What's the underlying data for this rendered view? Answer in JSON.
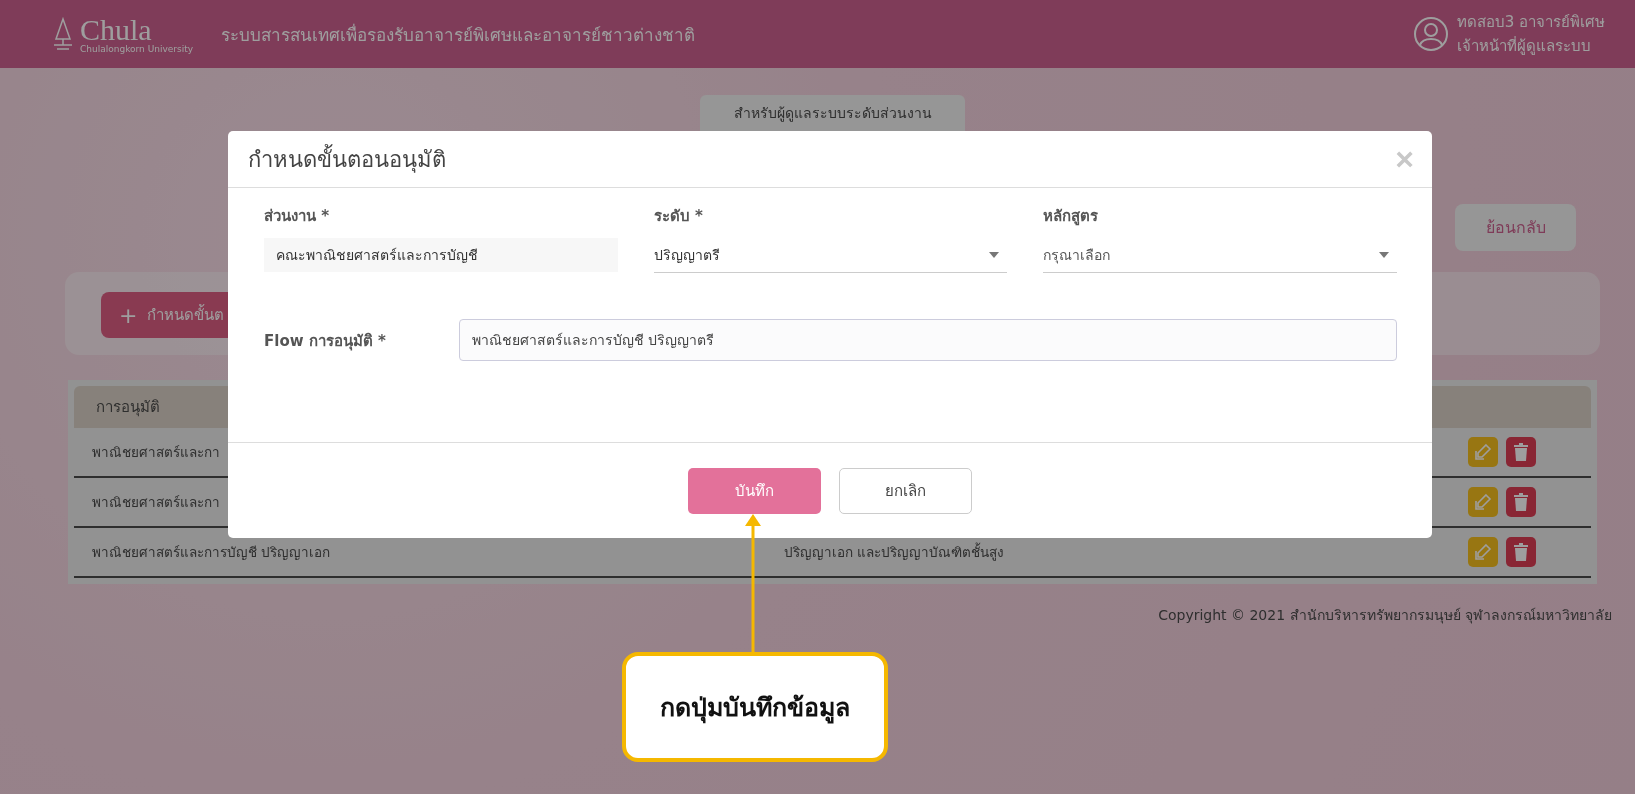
{
  "header": {
    "logo": {
      "name": "Chula",
      "subtitle": "Chulalongkorn University"
    },
    "system_title": "ระบบสารสนเทศเพื่อรองรับอาจารย์พิเศษและอาจารย์ชาวต่างชาติ",
    "user_name": "ทดสอบ3 อาจารย์พิเศษ",
    "user_role": "เจ้าหน้าที่ผู้ดูแลระบบ"
  },
  "tab": "สำหรับผู้ดูแลระบบระดับส่วนงาน",
  "back_button": "ย้อนกลับ",
  "add_button": {
    "icon": "+",
    "label": "กำหนดขั้นต"
  },
  "table": {
    "columns": [
      "การอนุมัติ"
    ],
    "rows": [
      {
        "cells": [
          "พาณิชยศาสตร์และกา"
        ]
      },
      {
        "cells": [
          "พาณิชยศาสตร์และกา"
        ]
      },
      {
        "cells": [
          "พาณิชยศาสตร์และการบัญชี ปริญญาเอก",
          "ปริญญาเอก และปริญญาบัณฑิตชั้นสูง"
        ]
      }
    ]
  },
  "copyright": "Copyright © 2021 สำนักบริหารทรัพยากรมนุษย์ จุฬาลงกรณ์มหาวิทยาลัย",
  "dialog": {
    "title": "กำหนดขั้นตอนอนุมัติ",
    "close": "×",
    "fields": [
      {
        "label": "ส่วนงาน *",
        "value": "คณะพาณิชยศาสตร์และการบัญชี",
        "kind": "readonly"
      },
      {
        "label": "ระดับ *",
        "value": "ปริญญาตรี",
        "kind": "select"
      },
      {
        "label": "หลักสูตร",
        "placeholder": "กรุณาเลือก",
        "kind": "select"
      }
    ],
    "flow": {
      "label": "Flow การอนุมัติ *",
      "value": "พาณิชยศาสตร์และการบัญชี ปริญญาตรี"
    },
    "buttons": [
      {
        "label": "บันทึก",
        "kind": "primary"
      },
      {
        "label": "ยกเลิก",
        "kind": "secondary"
      }
    ]
  },
  "annotation": {
    "text": "กดปุ่มบันทึกข้อมูล"
  }
}
